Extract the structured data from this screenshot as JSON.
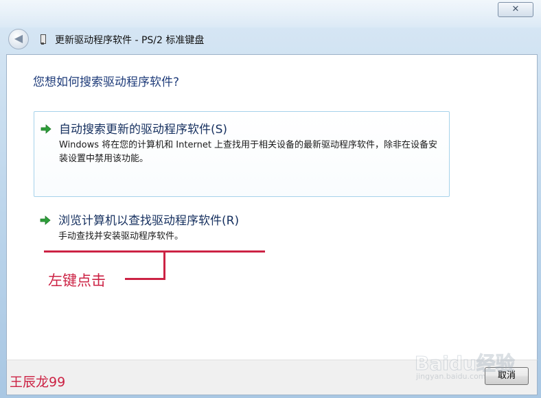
{
  "window": {
    "title": "更新驱动程序软件 - PS/2 标准键盘",
    "close_glyph": "✕",
    "back_glyph": "◀"
  },
  "main": {
    "question": "您想如何搜索驱动程序软件?",
    "options": [
      {
        "title": "自动搜索更新的驱动程序软件(S)",
        "description": "Windows 将在您的计算机和 Internet 上查找用于相关设备的最新驱动程序软件，除非在设备安装设置中禁用该功能。",
        "icon": "green-arrow-icon"
      },
      {
        "title": "浏览计算机以查找驱动程序软件(R)",
        "description": "手动查找并安装驱动程序软件。",
        "icon": "green-arrow-icon"
      }
    ]
  },
  "footer": {
    "cancel_label": "取消"
  },
  "annotation": {
    "text": "左键点击",
    "author": "王辰龙99",
    "color": "#cc2244"
  },
  "watermark": {
    "logo": "Baidu经验",
    "url": "jingyan.baidu.com"
  },
  "colors": {
    "link_blue": "#1f3c7a",
    "arrow_green": "#2e9e3a"
  }
}
